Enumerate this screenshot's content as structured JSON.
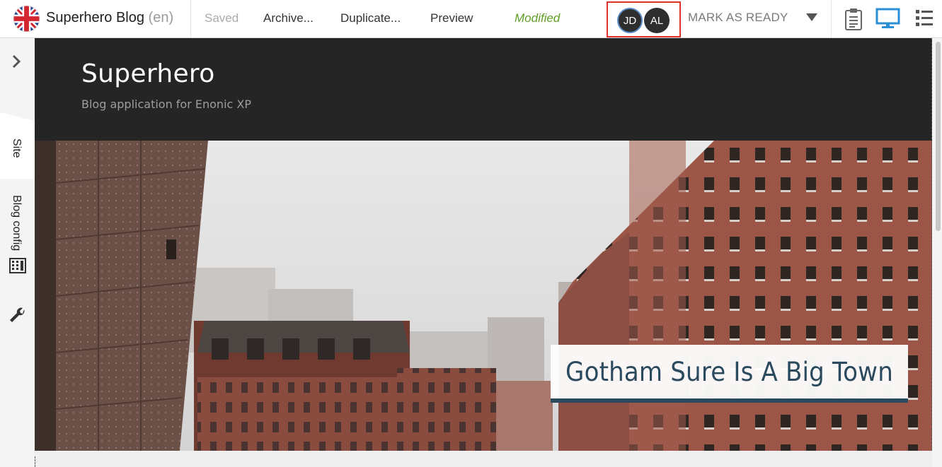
{
  "toolbar": {
    "app_title": "Superhero Blog",
    "language": "(en)",
    "saved_label": "Saved",
    "archive_label": "Archive...",
    "duplicate_label": "Duplicate...",
    "preview_label": "Preview",
    "status": "Modified",
    "collaborators": [
      "JD",
      "AL"
    ],
    "mark_ready_label": "MARK AS READY",
    "icons": [
      "clipboard-icon",
      "desktop-icon",
      "list-icon"
    ]
  },
  "sidebar": {
    "tabs": [
      {
        "label": "Site"
      },
      {
        "label": "Blog config"
      }
    ],
    "icons": [
      "chevron-right-icon",
      "grid-component-icon",
      "wrench-icon"
    ]
  },
  "preview": {
    "site_title": "Superhero",
    "site_subtitle": "Blog application for Enonic XP",
    "headline": "Gotham Sure Is A Big Town"
  },
  "colors": {
    "status_modified": "#609e24",
    "highlight_box": "#e0312b",
    "desktop_icon_active": "#2b8fd6",
    "headline": "#2b4a5e",
    "site_header_bg": "#252525"
  }
}
